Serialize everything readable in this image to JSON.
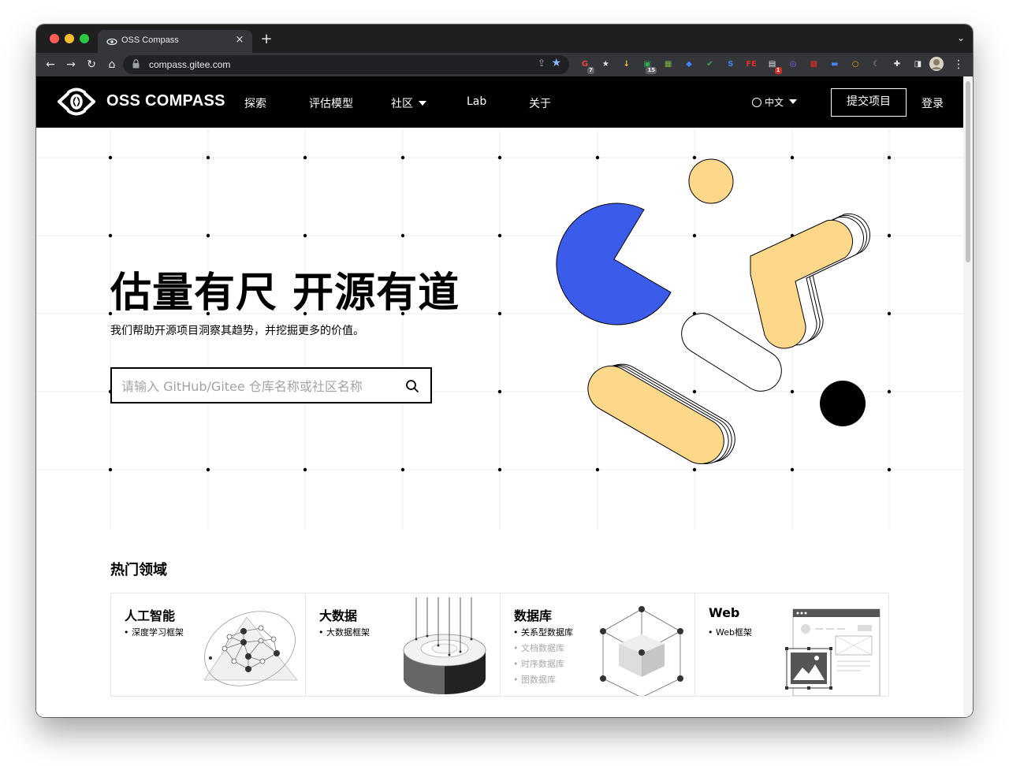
{
  "browser": {
    "tab_title": "OSS Compass",
    "tab_close": "×",
    "new_tab": "+",
    "url": "compass.gitee.com",
    "extensions": [
      {
        "name": "grammar-ext-icon",
        "color": "#e8453c",
        "badge": "7"
      },
      {
        "name": "star-ext-icon",
        "color": "#e8eaed"
      },
      {
        "name": "download-ext-icon",
        "color": "#f6c343"
      },
      {
        "name": "tab-ext-icon",
        "color": "#34a853",
        "badge": "15"
      },
      {
        "name": "grid-ext-icon",
        "color": "#7cb342"
      },
      {
        "name": "pin-ext-icon",
        "color": "#4285f4"
      },
      {
        "name": "shield-ext-icon",
        "color": "#34a853"
      },
      {
        "name": "s-ext-icon",
        "color": "#4285f4"
      },
      {
        "name": "fe-ext-icon",
        "color": "#d93025"
      },
      {
        "name": "notes-ext-icon",
        "color": "#e8eaed",
        "badge": "1"
      },
      {
        "name": "circle-ext-icon",
        "color": "#7b61ff"
      },
      {
        "name": "qr-ext-icon",
        "color": "#d93025"
      },
      {
        "name": "window-ext-icon",
        "color": "#4285f4"
      },
      {
        "name": "ring-ext-icon",
        "color": "#f9ab00"
      },
      {
        "name": "moon-ext-icon",
        "color": "#9aa0a6"
      },
      {
        "name": "puzzle-icon",
        "color": "#e8eaed"
      },
      {
        "name": "sidepanel-icon",
        "color": "#e8eaed"
      }
    ]
  },
  "header": {
    "brand": "OSS COMPASS",
    "nav": [
      "探索",
      "评估模型",
      "社区",
      "Lab",
      "关于"
    ],
    "lang": "中文",
    "submit": "提交项目",
    "login": "登录"
  },
  "hero": {
    "title": "估量有尺 开源有道",
    "subtitle": "我们帮助开源项目洞察其趋势，并挖掘更多的价值。",
    "search_placeholder": "请输入 GitHub/Gitee 仓库名称或社区名称"
  },
  "colors": {
    "blue": "#3b5bea",
    "yellow": "#fdd88a",
    "black": "#000000"
  },
  "hot": {
    "title": "热门领域",
    "cards": [
      {
        "title": "人工智能",
        "items": [
          {
            "text": "• 深度学习框架",
            "dim": false
          }
        ]
      },
      {
        "title": "大数据",
        "items": [
          {
            "text": "• 大数据框架",
            "dim": false
          }
        ]
      },
      {
        "title": "数据库",
        "items": [
          {
            "text": "• 关系型数据库",
            "dim": false
          },
          {
            "text": "• 文档数据库",
            "dim": true
          },
          {
            "text": "• 时序数据库",
            "dim": true
          },
          {
            "text": "• 图数据库",
            "dim": true
          }
        ]
      },
      {
        "title": "Web",
        "items": [
          {
            "text": "• Web框架",
            "dim": false
          }
        ]
      }
    ]
  }
}
